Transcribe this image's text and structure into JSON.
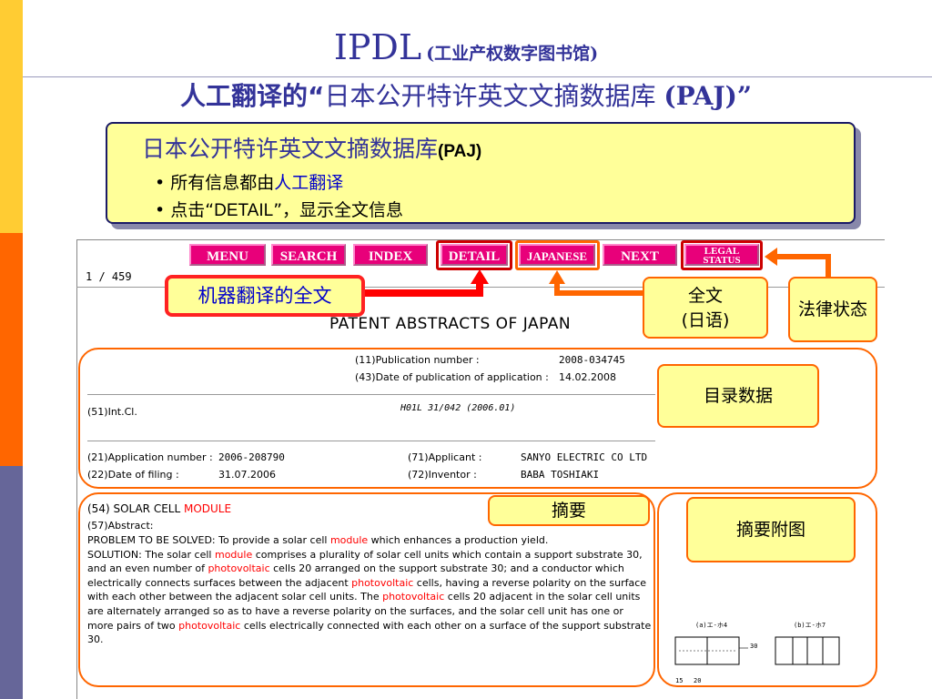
{
  "header": {
    "title_main": "IPDL",
    "title_sub": "(工业产权数字图书馆)",
    "subtitle_prefix": "人工翻译的“",
    "subtitle_middle": "日本公开特许英文文摘数据库 ",
    "subtitle_suffix": "(PAJ)”"
  },
  "info_box": {
    "title": "日本公开特许英文文摘数据库",
    "title_suffix": "(PAJ)",
    "bullet1_prefix": "• 所有信息都由",
    "bullet1_link": "人工翻译",
    "bullet2_prefix": "• 点击“",
    "bullet2_code": "DETAIL",
    "bullet2_suffix": "”，显示全文信息"
  },
  "nav": {
    "menu": "MENU",
    "search": "SEARCH",
    "index": "INDEX",
    "detail": "DETAIL",
    "japanese": "JAPANESE",
    "next": "NEXT",
    "legal_line1": "LEGAL",
    "legal_line2": "STATUS"
  },
  "page_count": "1 / 459",
  "patent_title": "PATENT ABSTRACTS OF JAPAN",
  "callouts": {
    "machine_translation": "机器翻译的全文",
    "fulltext_line1": "全文",
    "fulltext_line2": "(日语)",
    "legal_status": "法律状态",
    "bibliographic": "目录数据",
    "abstract": "摘要",
    "abstract_figure": "摘要附图"
  },
  "bibliographic": {
    "pub_number_label": "(11)Publication number :",
    "pub_number_value": "2008-034745",
    "pub_date_label": "(43)Date of publication of application :",
    "pub_date_value": "14.02.2008",
    "intcl_label": "(51)Int.Cl.",
    "intcl_value": "H01L   31/042       (2006.01)",
    "app_number_label": "(21)Application number :",
    "app_number_value": "2006-208790",
    "applicant_label": "(71)Applicant :",
    "applicant_value": "SANYO ELECTRIC CO LTD",
    "filing_date_label": "(22)Date of filing :",
    "filing_date_value": "31.07.2006",
    "inventor_label": "(72)Inventor :",
    "inventor_value": "BABA TOSHIAKI"
  },
  "abstract": {
    "title_prefix": "(54) SOLAR CELL ",
    "title_highlight": "MODULE",
    "label": "(57)Abstract:",
    "segments": [
      {
        "t": "PROBLEM TO BE SOLVED: To provide a solar cell ",
        "h": false
      },
      {
        "t": "module",
        "h": true
      },
      {
        "t": " which enhances a production yield.",
        "h": false
      },
      {
        "t": "\nSOLUTION: The solar cell ",
        "h": false
      },
      {
        "t": "module",
        "h": true
      },
      {
        "t": " comprises a plurality of solar cell units which contain a support substrate 30, and an even number of ",
        "h": false
      },
      {
        "t": "photovoltaic",
        "h": true
      },
      {
        "t": " cells 20 arranged on the support substrate 30; and a conductor which electrically connects surfaces between the adjacent ",
        "h": false
      },
      {
        "t": "photovoltaic",
        "h": true
      },
      {
        "t": " cells, having a reverse polarity on the surface with each other between the adjacent solar cell units. The ",
        "h": false
      },
      {
        "t": "photovoltaic",
        "h": true
      },
      {
        "t": " cells 20 adjacent in the solar cell units are alternately arranged so as to have a reverse polarity on the surfaces, and the solar cell unit has one or more pairs of two ",
        "h": false
      },
      {
        "t": "photovoltaic",
        "h": true
      },
      {
        "t": " cells electrically connected with each other on a surface of the support substrate 30.",
        "h": false
      }
    ]
  },
  "figure": {
    "label_left": "(a)エ-ホ4",
    "label_right": "(b)エ-ホ7",
    "callout_30": "30",
    "callout_15": "15",
    "callout_20": "20"
  },
  "colors": {
    "strip_top": "#ffcc33",
    "strip_mid": "#ff6600",
    "strip_bottom": "#666699",
    "title": "#333399",
    "nav_button": "#e8007a",
    "highlight_red": "#ff0000",
    "callout_fill": "#ffff99",
    "accent_orange": "#ff6600"
  }
}
